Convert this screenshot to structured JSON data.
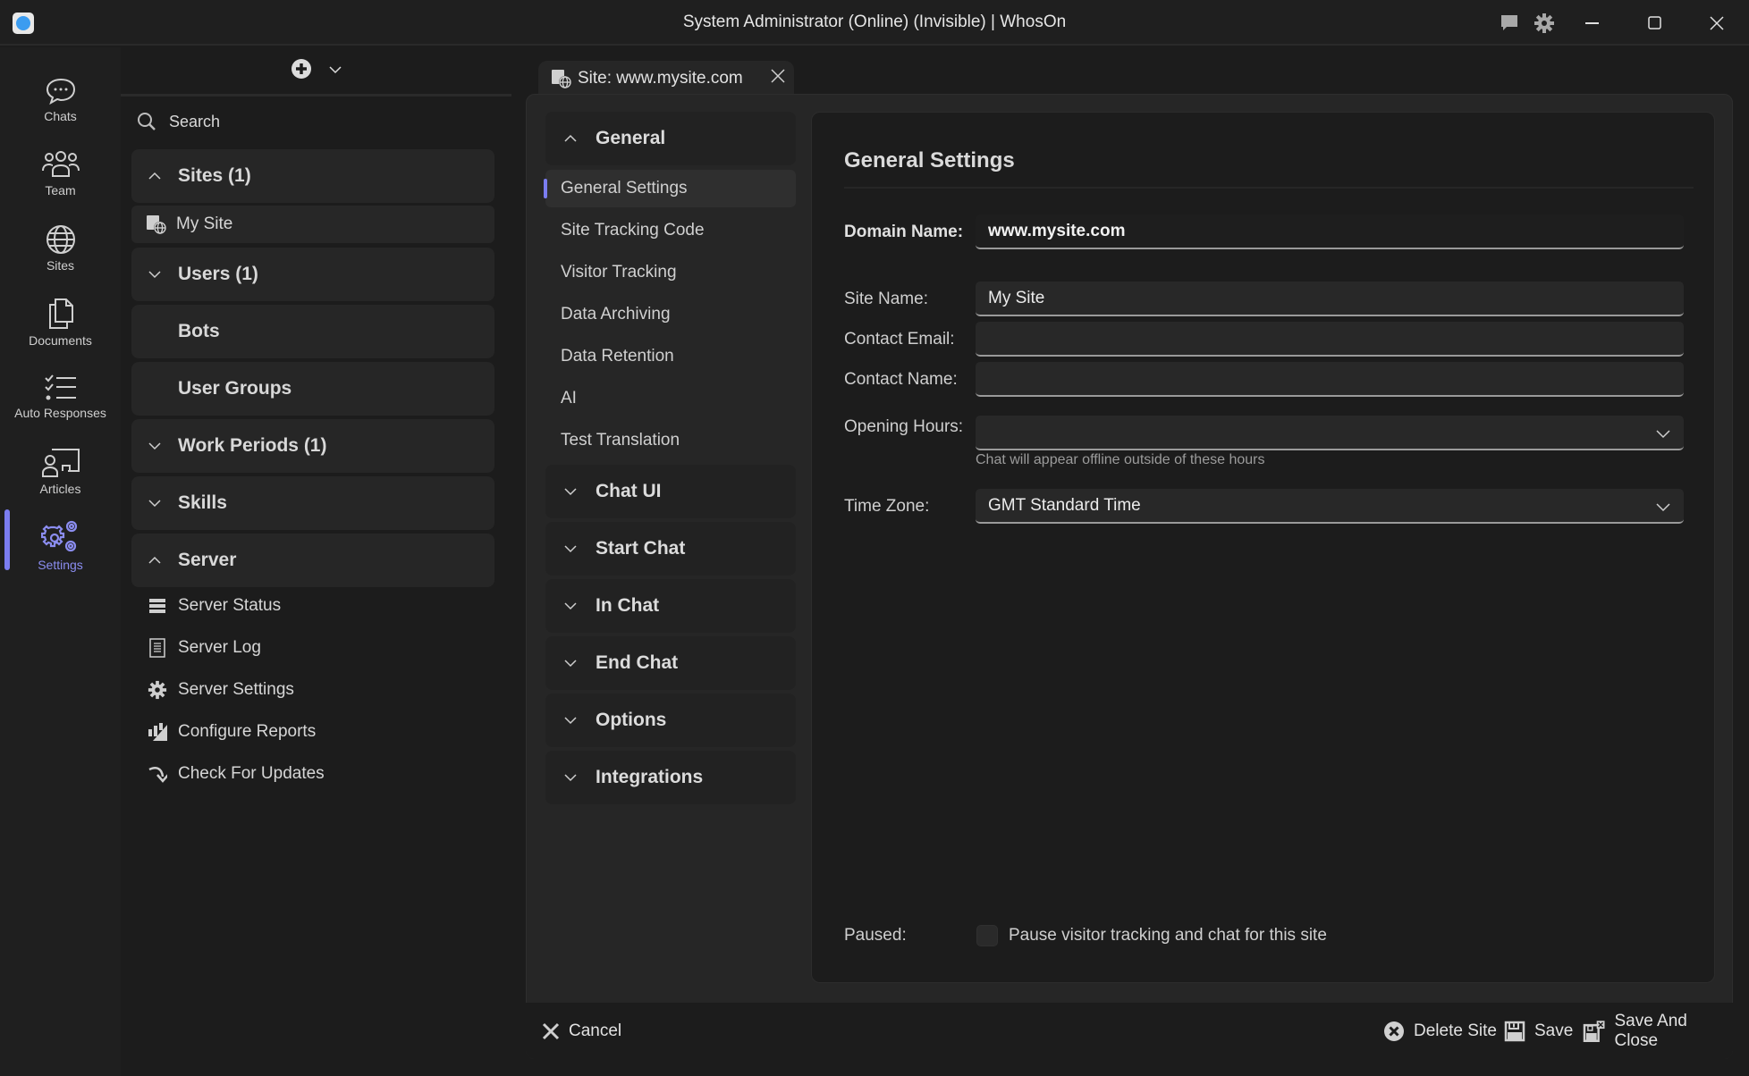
{
  "window": {
    "title": "System Administrator (Online) (Invisible) | WhosOn",
    "controls": [
      "chat-bubble",
      "settings",
      "minimize",
      "maximize",
      "close"
    ]
  },
  "leftnav": {
    "items": [
      {
        "label": "Chats",
        "icon": "chat-bubble-icon"
      },
      {
        "label": "Team",
        "icon": "team-icon"
      },
      {
        "label": "Sites",
        "icon": "globe-icon"
      },
      {
        "label": "Documents",
        "icon": "documents-icon"
      },
      {
        "label": "Auto Responses",
        "icon": "checklist-icon"
      },
      {
        "label": "Articles",
        "icon": "articles-icon"
      },
      {
        "label": "Settings",
        "icon": "settings-gears-icon",
        "active": true
      }
    ],
    "accent": "#7b7df0"
  },
  "sidebar": {
    "search_placeholder": "Search",
    "groups": [
      {
        "label": "Sites (1)",
        "expanded": true
      },
      {
        "label": "Users (1)",
        "expanded": false
      },
      {
        "label": "Bots"
      },
      {
        "label": "User Groups"
      },
      {
        "label": "Work Periods (1)",
        "expanded": false
      },
      {
        "label": "Skills",
        "expanded": false
      },
      {
        "label": "Server",
        "expanded": true
      }
    ],
    "site_item": "My Site",
    "server_items": [
      {
        "label": "Server Status",
        "icon": "server-status-icon"
      },
      {
        "label": "Server Log",
        "icon": "log-icon"
      },
      {
        "label": "Server Settings",
        "icon": "gear-icon"
      },
      {
        "label": "Configure Reports",
        "icon": "reports-icon"
      },
      {
        "label": "Check For Updates",
        "icon": "update-arrow-icon"
      }
    ]
  },
  "tab": {
    "label": "Site: www.mysite.com"
  },
  "settings_nav": {
    "general": "General",
    "general_items": [
      "General Settings",
      "Site Tracking Code",
      "Visitor Tracking",
      "Data Archiving",
      "Data Retention",
      "AI",
      "Test Translation"
    ],
    "selected": "General Settings",
    "categories": [
      "Chat UI",
      "Start Chat",
      "In Chat",
      "End Chat",
      "Options",
      "Integrations"
    ]
  },
  "form": {
    "title": "General Settings",
    "domain_label": "Domain Name:",
    "domain_value": "www.mysite.com",
    "site_name_label": "Site Name:",
    "site_name_value": "My Site",
    "contact_email_label": "Contact Email:",
    "contact_email_value": "",
    "contact_name_label": "Contact Name:",
    "contact_name_value": "",
    "opening_hours_label": "Opening Hours:",
    "opening_hours_value": "",
    "opening_hours_hint": "Chat will appear offline outside of these hours",
    "time_zone_label": "Time Zone:",
    "time_zone_value": "GMT Standard Time",
    "paused_label": "Paused:",
    "paused_text": "Pause visitor tracking and chat for this site",
    "paused_checked": false
  },
  "footer": {
    "cancel": "Cancel",
    "delete": "Delete Site",
    "save": "Save",
    "save_close": "Save And Close"
  }
}
